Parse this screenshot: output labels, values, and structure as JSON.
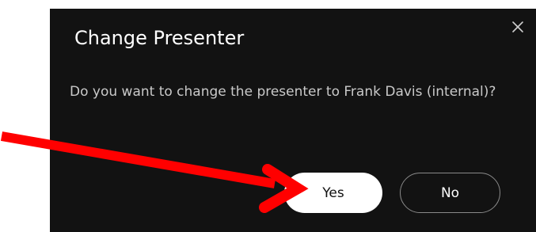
{
  "dialog": {
    "title": "Change Presenter",
    "message": "Do you want to change the presenter to Frank Davis (internal)?",
    "yes_label": "Yes",
    "no_label": "No",
    "close_icon": "close-icon"
  },
  "annotation": {
    "icon": "red-arrow-icon",
    "color": "#ff0000"
  },
  "colors": {
    "dialog_background": "#121212",
    "primary_button": "#ffffff",
    "secondary_button_border": "#8a8a8a"
  }
}
